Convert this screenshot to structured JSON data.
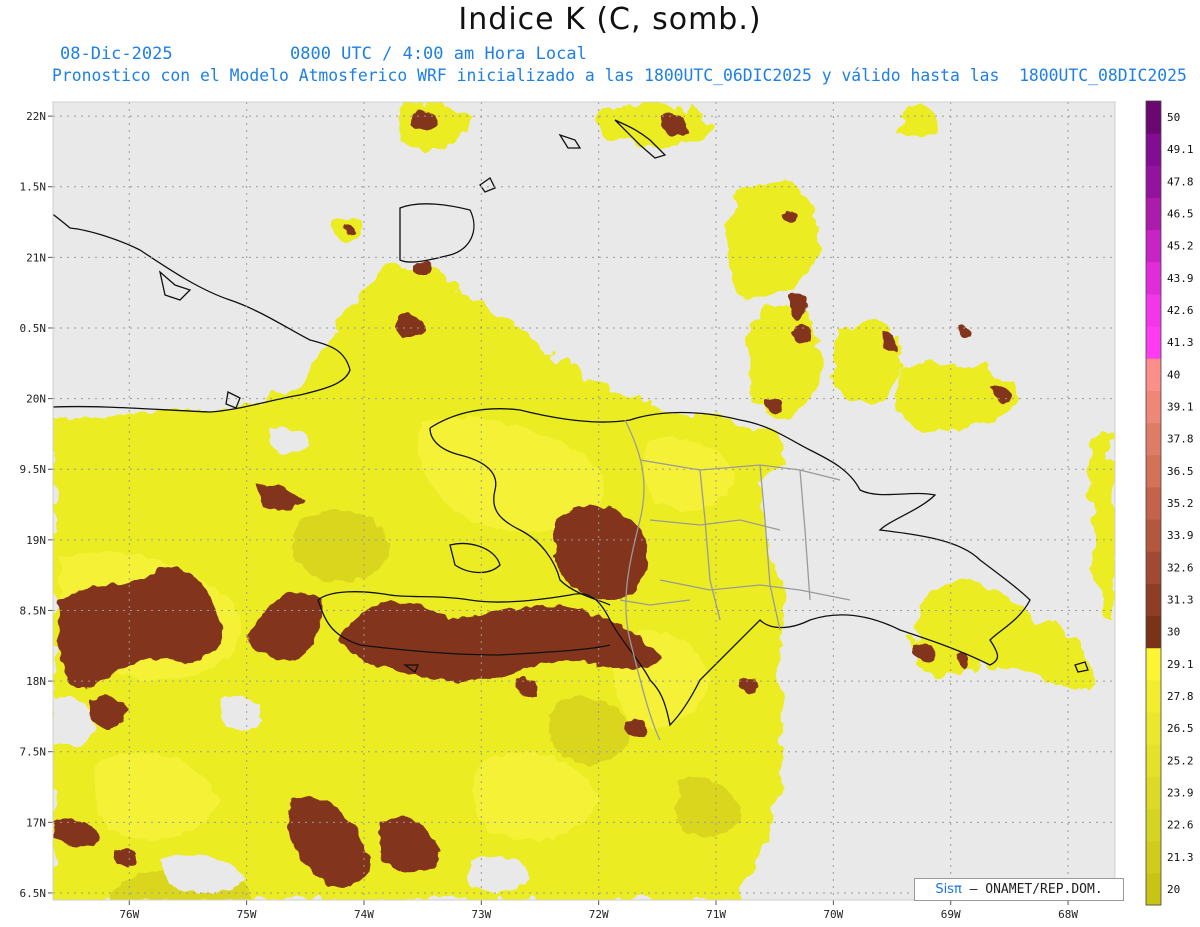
{
  "chart_data": {
    "type": "heatmap",
    "title": "Indice K (C, somb.)",
    "date_label": "08-Dic-2025",
    "time_label": "0800 UTC / 4:00 am Hora Local",
    "subtitle": "Pronostico con el Modelo Atmosferico WRF inicializado a las 1800UTC_06DIC2025 y válido hasta las  1800UTC_08DIC2025",
    "lon_range": [
      -76.65,
      -67.6
    ],
    "lat_range": [
      16.45,
      22.1
    ],
    "lon_ticks": [
      -76,
      -75,
      -74,
      -73,
      -72,
      -71,
      -70,
      -69,
      -68
    ],
    "lon_tick_labels": [
      "76W",
      "75W",
      "74W",
      "73W",
      "72W",
      "71W",
      "70W",
      "69W",
      "68W"
    ],
    "lat_ticks": [
      22,
      21.5,
      21,
      20.5,
      20,
      19.5,
      19,
      18.5,
      18,
      17.5,
      17,
      16.5
    ],
    "lat_tick_labels": [
      "22N",
      "1.5N",
      "21N",
      "0.5N",
      "20N",
      "9.5N",
      "19N",
      "8.5N",
      "18N",
      "7.5N",
      "17N",
      "6.5N"
    ],
    "grid": true,
    "colorbar": {
      "levels": [
        "20",
        "21.3",
        "22.6",
        "23.9",
        "25.2",
        "26.5",
        "27.8",
        "29.1",
        "30",
        "31.3",
        "32.6",
        "33.9",
        "35.2",
        "36.5",
        "37.8",
        "39.1",
        "40",
        "41.3",
        "42.6",
        "43.9",
        "45.2",
        "46.5",
        "47.8",
        "49.1",
        "50"
      ],
      "colors": [
        "#c8c414",
        "#cfcc1c",
        "#d6d423",
        "#dcda27",
        "#e3e12a",
        "#ebe72c",
        "#f3ed2f",
        "#fcf534",
        "#7a3319",
        "#8e3e25",
        "#a14a33",
        "#b4573f",
        "#c3634b",
        "#d27358",
        "#e07c66",
        "#ef8777",
        "#fc8f8a",
        "#ff3cf2",
        "#f336ea",
        "#e12dd9",
        "#c823c5",
        "#ad1bad",
        "#9412a0",
        "#830c92",
        "#6a0770"
      ]
    },
    "regions": [
      {
        "category": "K >= 30 (somb.)",
        "approx_lon": -73.4,
        "approx_lat": 18.3
      },
      {
        "category": "K >= 30 (somb.)",
        "approx_lon": -75.8,
        "approx_lat": 18.4
      },
      {
        "category": "K >= 30 (somb.)",
        "approx_lon": -73.6,
        "approx_lat": 17.0
      },
      {
        "category": "K >= 30 (somb.)",
        "approx_lon": -72.0,
        "approx_lat": 18.9
      },
      {
        "category": "K >= 30 (somb.)",
        "approx_lon": -70.4,
        "approx_lat": 20.7
      }
    ],
    "credit_logo": "Sisπ",
    "credit_text": "ONAMET/REP.DOM."
  }
}
